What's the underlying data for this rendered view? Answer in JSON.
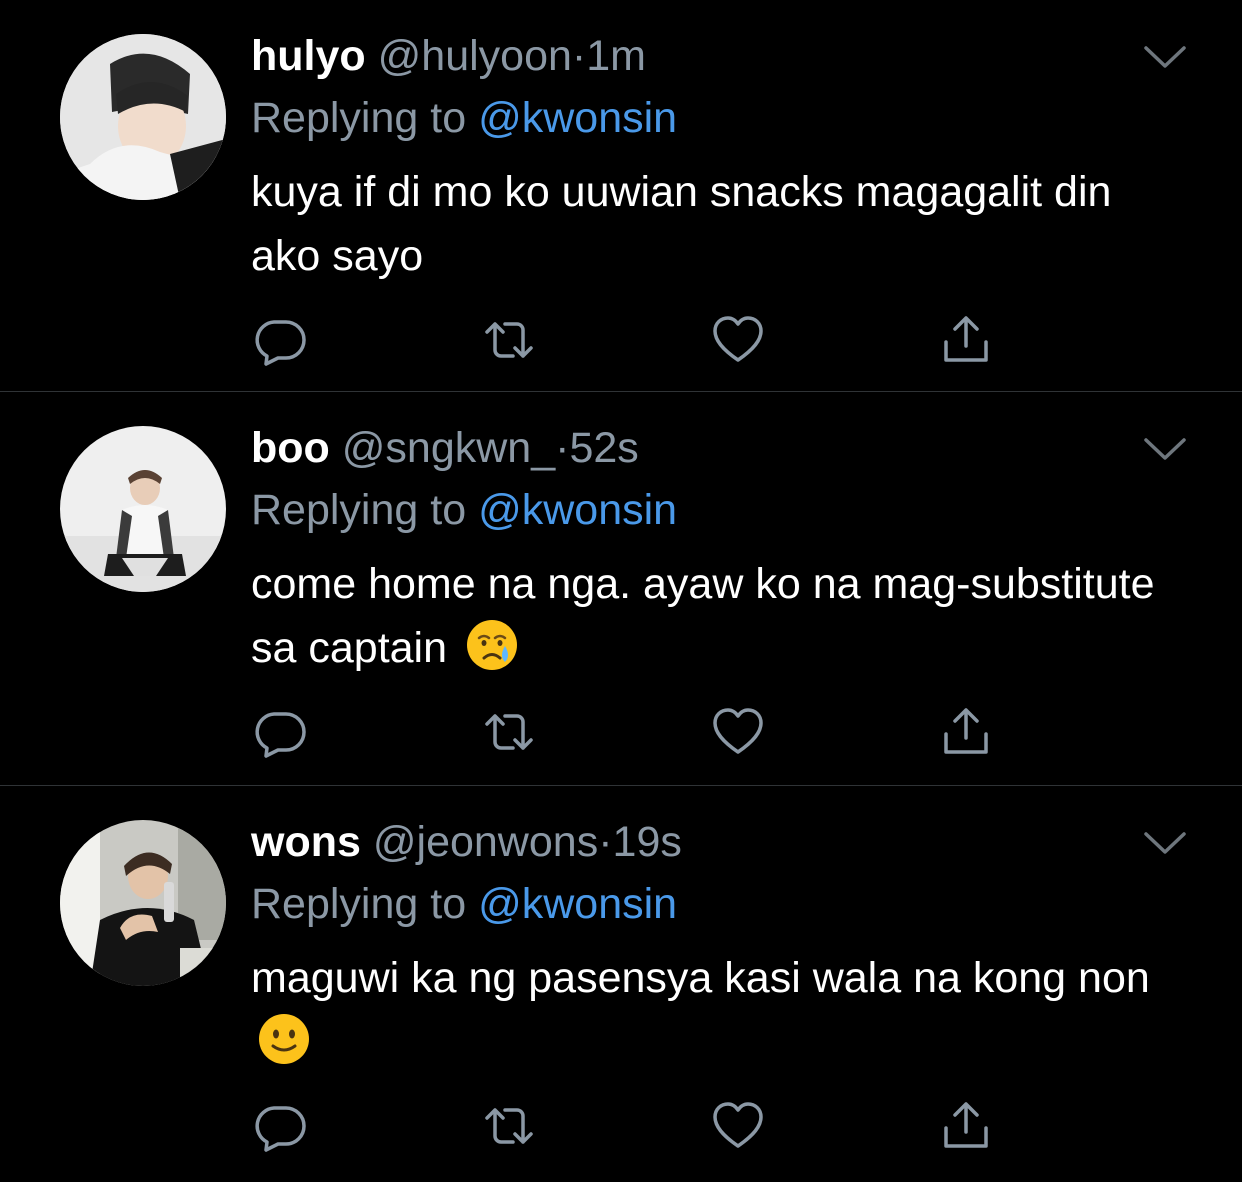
{
  "colors": {
    "background": "#000000",
    "primary_text": "#ffffff",
    "secondary_text": "#8b98a5",
    "mention": "#4a99e9",
    "divider": "#2f3336"
  },
  "tweets": [
    {
      "display_name": "hulyo",
      "handle": "@hulyoon",
      "separator": "·",
      "time": "1m",
      "replying_prefix": "Replying to",
      "replying_to": "@kwonsin",
      "text": "kuya if di mo ko uuwian snacks magagalit din ako sayo",
      "emoji": ""
    },
    {
      "display_name": "boo",
      "handle": "@sngkwn_",
      "separator": "·",
      "time": "52s",
      "replying_prefix": "Replying to",
      "replying_to": "@kwonsin",
      "text": "come home na nga. ayaw ko na mag-substitute sa captain",
      "emoji": "crying-face"
    },
    {
      "display_name": "wons",
      "handle": "@jeonwons",
      "separator": "·",
      "time": "19s",
      "replying_prefix": "Replying to",
      "replying_to": "@kwonsin",
      "text": "maguwi ka ng pasensya kasi wala na kong non",
      "emoji": "slightly-smiling-face"
    }
  ],
  "icons": {
    "more": "chevron-down-icon",
    "reply": "reply-bubble-icon",
    "retweet": "retweet-icon",
    "like": "heart-icon",
    "share": "share-icon"
  }
}
